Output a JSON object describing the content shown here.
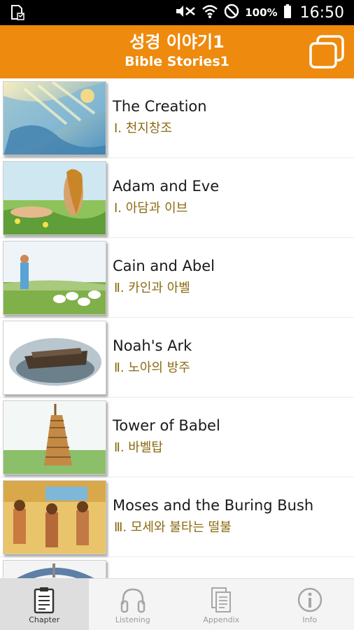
{
  "status_bar": {
    "battery": "100%",
    "time": "16:50",
    "icons": [
      "sd-card-icon",
      "mute-icon",
      "wifi-icon",
      "do-not-disturb-icon",
      "battery-icon"
    ]
  },
  "header": {
    "title_ko": "성경 이야기1",
    "title_en": "Bible Stories1",
    "background_color": "#ee8a0d",
    "right_icon": "windows-icon"
  },
  "stories": [
    {
      "title": "The Creation",
      "subtitle": "Ⅰ. 천지창조",
      "image": "creation-image"
    },
    {
      "title": "Adam and Eve",
      "subtitle": "Ⅰ. 아담과 이브",
      "image": "adam-eve-image"
    },
    {
      "title": "Cain and Abel",
      "subtitle": "Ⅱ. 카인과 아벨",
      "image": "cain-abel-image"
    },
    {
      "title": "Noah's Ark",
      "subtitle": "Ⅱ. 노아의 방주",
      "image": "noahs-ark-image"
    },
    {
      "title": "Tower of Babel",
      "subtitle": "Ⅱ. 바벨탑",
      "image": "babel-image"
    },
    {
      "title": "Moses and the Buring Bush",
      "subtitle": "Ⅲ. 모세와 불타는 떨불",
      "image": "moses-image"
    },
    {
      "title": "",
      "subtitle": "",
      "image": "partial-image"
    }
  ],
  "bottom_nav": {
    "active": "Chapter",
    "tabs": [
      {
        "label": "Chapter",
        "icon": "clipboard-icon"
      },
      {
        "label": "Listening",
        "icon": "headphones-icon"
      },
      {
        "label": "Appendix",
        "icon": "documents-icon"
      },
      {
        "label": "Info",
        "icon": "info-icon"
      }
    ]
  },
  "subtitle_color": "#8a6a10"
}
